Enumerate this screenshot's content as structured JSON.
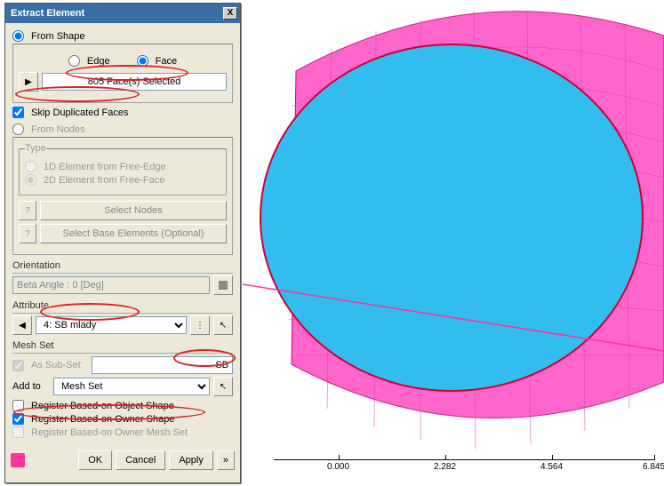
{
  "dialog": {
    "title": "Extract Element",
    "close": "X"
  },
  "fromShape": {
    "label": "From Shape",
    "edge": "Edge",
    "face": "Face",
    "selection": "805 Face(s) Selected",
    "skipDup": "Skip Duplicated Faces"
  },
  "fromNodes": {
    "label": "From Nodes",
    "typeLabel": "Type",
    "opt1d": "1D Element from Free-Edge",
    "opt2d": "2D Element from Free-Face",
    "selectNodes": "Select Nodes",
    "selectBase": "Select Base Elements (Optional)"
  },
  "orientation": {
    "label": "Orientation",
    "value": "Beta Angle : 0 [Deg]"
  },
  "attribute": {
    "label": "Attribute",
    "value": "4: SB mlady"
  },
  "meshSet": {
    "label": "Mesh Set",
    "asSubset": "As Sub-Set",
    "name": "SB",
    "addTo": "Add to",
    "addToValue": "Mesh Set",
    "regObj": "Register Based-on Object Shape",
    "regOwner": "Register Based-on Owner Shape",
    "regMesh": "Register Based-on Owner Mesh Set"
  },
  "buttons": {
    "ok": "OK",
    "cancel": "Cancel",
    "apply": "Apply",
    "more": "»"
  },
  "ruler": {
    "t0": "0.000",
    "t1": "2.282",
    "t2": "4.564",
    "t3": "6.845"
  }
}
